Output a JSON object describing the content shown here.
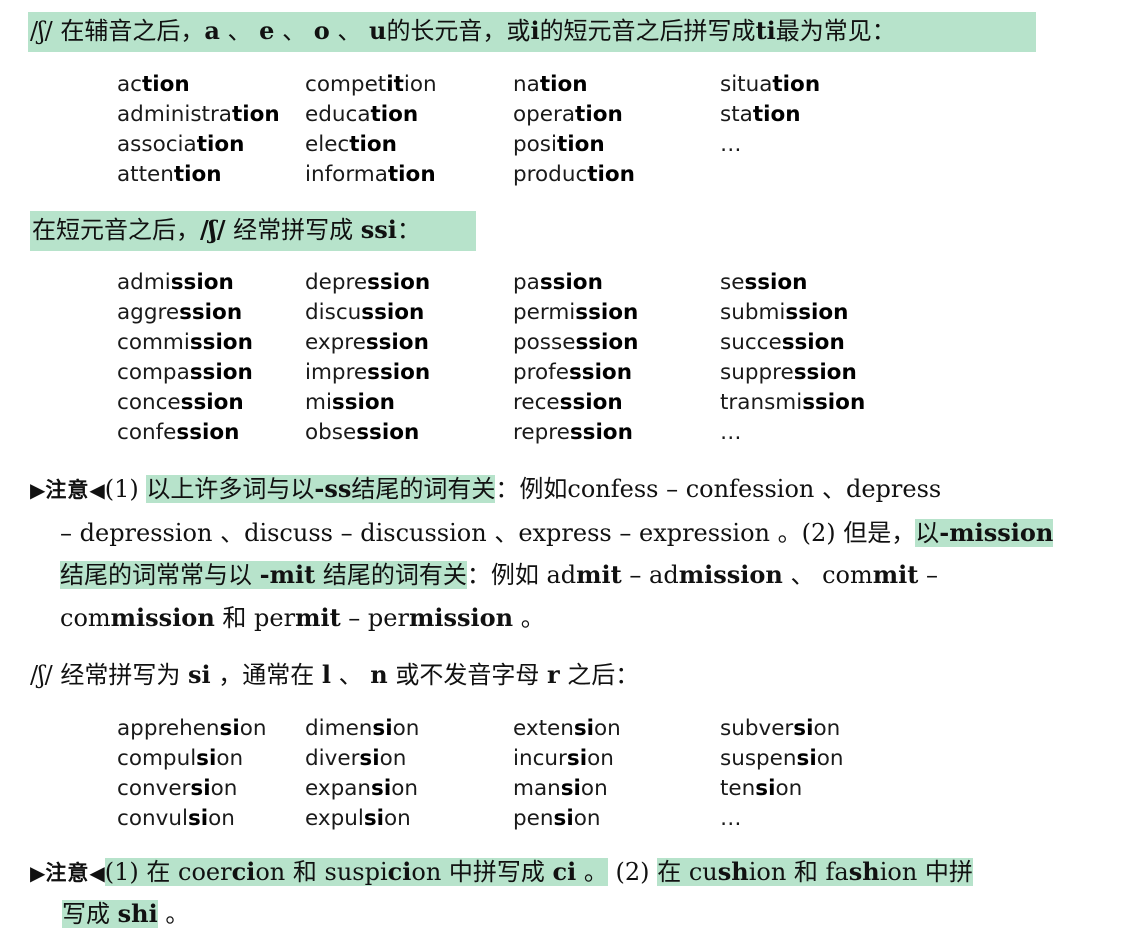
{
  "sections": [
    {
      "heading": {
        "parts": [
          {
            "t": "/ʃ/ 在辅音之后，",
            "b": false
          },
          {
            "t": "a",
            "b": true
          },
          {
            "t": " 、 ",
            "b": false
          },
          {
            "t": "e",
            "b": true
          },
          {
            "t": " 、 ",
            "b": false
          },
          {
            "t": "o",
            "b": true
          },
          {
            "t": " 、 ",
            "b": false
          },
          {
            "t": "u",
            "b": true
          },
          {
            "t": "的长元音，或",
            "b": false
          },
          {
            "t": "i",
            "b": true
          },
          {
            "t": "的短元音之后拼写成",
            "b": false
          },
          {
            "t": "ti",
            "b": true
          },
          {
            "t": "最为常见：",
            "b": false
          }
        ]
      },
      "words": [
        [
          "ac",
          "tion",
          ""
        ],
        [
          "compet",
          "it",
          "ion"
        ],
        [
          "na",
          "tion",
          ""
        ],
        [
          "situa",
          "tion",
          ""
        ],
        [
          "administra",
          "tion",
          ""
        ],
        [
          "educa",
          "tion",
          ""
        ],
        [
          "opera",
          "tion",
          ""
        ],
        [
          "sta",
          "tion",
          ""
        ],
        [
          "associa",
          "tion",
          ""
        ],
        [
          "elec",
          "tion",
          ""
        ],
        [
          "posi",
          "tion",
          ""
        ],
        [
          "…",
          "",
          ""
        ],
        [
          "atten",
          "tion",
          ""
        ],
        [
          "informa",
          "tion",
          ""
        ],
        [
          "produc",
          "tion",
          ""
        ],
        [
          "",
          "",
          ""
        ]
      ]
    },
    {
      "heading": {
        "parts": [
          {
            "t": "在短元音之后，",
            "b": false
          },
          {
            "t": "/ʃ/",
            "b": true
          },
          {
            "t": " 经常拼写成 ",
            "b": false
          },
          {
            "t": "ssi",
            "b": true
          },
          {
            "t": "：",
            "b": false
          }
        ]
      },
      "words": [
        [
          "admi",
          "ssion",
          ""
        ],
        [
          "depre",
          "ssion",
          ""
        ],
        [
          "pa",
          "ssion",
          ""
        ],
        [
          "se",
          "ssion",
          ""
        ],
        [
          "aggre",
          "ssion",
          ""
        ],
        [
          "discu",
          "ssion",
          ""
        ],
        [
          "permi",
          "ssion",
          ""
        ],
        [
          "submi",
          "ssion",
          ""
        ],
        [
          "commi",
          "ssion",
          ""
        ],
        [
          "expre",
          "ssion",
          ""
        ],
        [
          "posse",
          "ssion",
          ""
        ],
        [
          "succe",
          "ssion",
          ""
        ],
        [
          "compa",
          "ssion",
          ""
        ],
        [
          "impre",
          "ssion",
          ""
        ],
        [
          "profe",
          "ssion",
          ""
        ],
        [
          "suppre",
          "ssion",
          ""
        ],
        [
          "conce",
          "ssion",
          ""
        ],
        [
          "mi",
          "ssion",
          ""
        ],
        [
          "rece",
          "ssion",
          ""
        ],
        [
          "transmi",
          "ssion",
          ""
        ],
        [
          "confe",
          "ssion",
          ""
        ],
        [
          "obse",
          "ssion",
          ""
        ],
        [
          "repre",
          "ssion",
          ""
        ],
        [
          "…",
          "",
          ""
        ]
      ]
    },
    {
      "heading": {
        "parts": [
          {
            "t": "/ʃ/ 经常拼写为 ",
            "b": false
          },
          {
            "t": "si",
            "b": true
          },
          {
            "t": " ，通常在 ",
            "b": false
          },
          {
            "t": "l",
            "b": true
          },
          {
            "t": " 、 ",
            "b": false
          },
          {
            "t": "n",
            "b": true
          },
          {
            "t": " 或不发音字母 ",
            "b": false
          },
          {
            "t": "r",
            "b": true
          },
          {
            "t": " 之后：",
            "b": false
          }
        ]
      },
      "words": [
        [
          "apprehen",
          "si",
          "on"
        ],
        [
          "dimen",
          "si",
          "on"
        ],
        [
          "exten",
          "si",
          "on"
        ],
        [
          "subver",
          "si",
          "on"
        ],
        [
          "compul",
          "si",
          "on"
        ],
        [
          "diver",
          "si",
          "on"
        ],
        [
          "incur",
          "si",
          "on"
        ],
        [
          "suspen",
          "si",
          "on"
        ],
        [
          "conver",
          "si",
          "on"
        ],
        [
          "expan",
          "si",
          "on"
        ],
        [
          "man",
          "si",
          "on"
        ],
        [
          "ten",
          "si",
          "on"
        ],
        [
          "convul",
          "si",
          "on"
        ],
        [
          "expul",
          "si",
          "on"
        ],
        [
          "pen",
          "si",
          "on"
        ],
        [
          "…",
          "",
          ""
        ]
      ]
    }
  ],
  "notes": {
    "marker_left": "▶",
    "label": "注意",
    "marker_right": "◀",
    "note1": {
      "l1a": "(1) ",
      "l1b_hl": "以上许多词与以",
      "l1c_hl_bold": "-ss",
      "l1d_hl": "结尾的词有关",
      "l1e": "：例如confess – confession 、depress",
      "l2": "– depression 、discuss – discussion 、express – expression 。(2) 但是，",
      "l2_hl_a": "以",
      "l2_hl_b": "-mission",
      "l3_hl_a": "结尾的词常常与以 ",
      "l3_hl_b": "-mit",
      "l3_hl_c": " 结尾的词有关",
      "l3_rest_a": "：例如 ad",
      "l3_rest_b": "mit",
      "l3_rest_c": " – ad",
      "l3_rest_d": "mission",
      "l3_rest_e": " 、 com",
      "l3_rest_f": "mit",
      "l3_rest_g": " –",
      "l4_a": "com",
      "l4_b": "mission",
      "l4_c": " 和 per",
      "l4_d": "mit",
      "l4_e": " – per",
      "l4_f": "mission",
      "l4_g": " 。"
    },
    "note2": {
      "a_hl": "(1) 在 coer",
      "a_hl_b": "ci",
      "a_hl_c": "on 和 suspi",
      "a_hl_d": "ci",
      "a_hl_e": "on 中拼写成 ",
      "a_hl_f": "ci",
      "a_hl_g": " 。",
      "b": " (2) ",
      "c_hl": "在 cu",
      "c_hl_b": "sh",
      "c_hl_c": "ion 和 fa",
      "c_hl_d": "sh",
      "c_hl_e": "ion 中拼",
      "l2_hl": "写成 ",
      "l2_hl_b": "shi",
      "l2_end": " 。"
    }
  }
}
